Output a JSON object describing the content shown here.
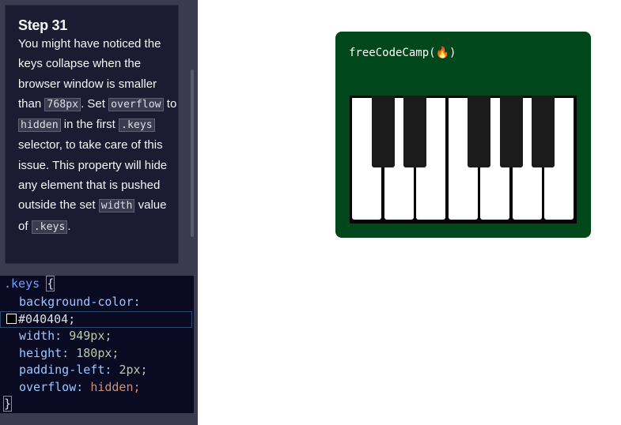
{
  "instructions": {
    "step_title": "Step 31",
    "text_1": "You might have noticed the keys collapse when the browser window is smaller than ",
    "code_1": "768px",
    "text_2": ". Set ",
    "code_2": "overflow",
    "text_3": " to ",
    "code_3": "hidden",
    "text_4": " in the first ",
    "code_4": ".keys",
    "text_5": " selector, to take care of this issue. This property will hide any element that is pushed outside the set ",
    "code_5": "width",
    "text_6": " value of ",
    "code_6": ".keys",
    "text_7": "."
  },
  "editor": {
    "selector": ".keys",
    "open_brace": "{",
    "bg_prop": "background-color:",
    "bg_value": "#040404;",
    "width_prop": "width:",
    "width_value": "949px;",
    "height_prop": "height:",
    "height_value": "180px;",
    "padding_prop": "padding-left:",
    "padding_value": "2px;",
    "overflow_prop": "overflow:",
    "overflow_value": "hidden;",
    "close_brace": "}"
  },
  "preview": {
    "logo_text": "freeCodeCamp(🔥)",
    "white_key_count": 7,
    "black_key_count": 5,
    "background_color": "#00471b",
    "keys_color": "#040404"
  }
}
